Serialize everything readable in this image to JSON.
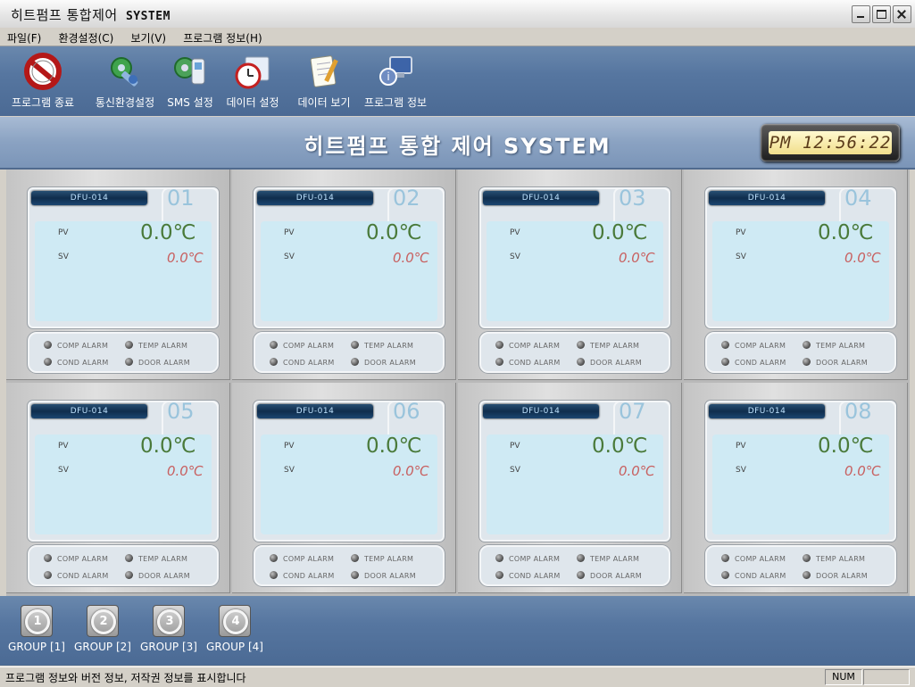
{
  "window": {
    "title": "히트펌프 통합제어",
    "title_suffix": "SYSTEM"
  },
  "menu": [
    "파일(F)",
    "환경설정(C)",
    "보기(V)",
    "프로그램 정보(H)"
  ],
  "toolbar": [
    {
      "label": "프로그램 종료",
      "icon": "no-entry-icon"
    },
    {
      "label": "통신환경설정",
      "icon": "wrench-gear-icon"
    },
    {
      "label": "SMS 설정",
      "icon": "phone-gear-icon"
    },
    {
      "label": "데이터 설정",
      "icon": "clock-folder-icon"
    },
    {
      "label": "데이터 보기",
      "icon": "notepad-icon"
    },
    {
      "label": "프로그램 정보",
      "icon": "computer-info-icon"
    }
  ],
  "header": {
    "title": "히트펌프 통합 제어 SYSTEM",
    "clock": "PM 12:56:22"
  },
  "units": [
    {
      "name": "DFU-014",
      "number": "01",
      "pv_label": "PV",
      "sv_label": "SV",
      "pv": "0.0℃",
      "sv": "0.0℃"
    },
    {
      "name": "DFU-014",
      "number": "02",
      "pv_label": "PV",
      "sv_label": "SV",
      "pv": "0.0℃",
      "sv": "0.0℃"
    },
    {
      "name": "DFU-014",
      "number": "03",
      "pv_label": "PV",
      "sv_label": "SV",
      "pv": "0.0℃",
      "sv": "0.0℃"
    },
    {
      "name": "DFU-014",
      "number": "04",
      "pv_label": "PV",
      "sv_label": "SV",
      "pv": "0.0℃",
      "sv": "0.0℃"
    },
    {
      "name": "DFU-014",
      "number": "05",
      "pv_label": "PV",
      "sv_label": "SV",
      "pv": "0.0℃",
      "sv": "0.0℃"
    },
    {
      "name": "DFU-014",
      "number": "06",
      "pv_label": "PV",
      "sv_label": "SV",
      "pv": "0.0℃",
      "sv": "0.0℃"
    },
    {
      "name": "DFU-014",
      "number": "07",
      "pv_label": "PV",
      "sv_label": "SV",
      "pv": "0.0℃",
      "sv": "0.0℃"
    },
    {
      "name": "DFU-014",
      "number": "08",
      "pv_label": "PV",
      "sv_label": "SV",
      "pv": "0.0℃",
      "sv": "0.0℃"
    }
  ],
  "alarms": {
    "comp": "COMP ALARM",
    "temp": "TEMP ALARM",
    "cond": "COND ALARM",
    "door": "DOOR ALARM"
  },
  "groups": [
    {
      "label": "GROUP [1]",
      "digit": "1"
    },
    {
      "label": "GROUP [2]",
      "digit": "2"
    },
    {
      "label": "GROUP [3]",
      "digit": "3"
    },
    {
      "label": "GROUP [4]",
      "digit": "4"
    }
  ],
  "status": {
    "message": "프로그램 정보와 버전 정보, 저작권 정보를 표시합니다",
    "num": "NUM"
  },
  "colors": {
    "toolbar_bg": "#5676a0",
    "lcd": "#cfeaf4",
    "pv": "#4a7a3a",
    "sv": "#c86060",
    "clock_face": "#f1df8c"
  }
}
